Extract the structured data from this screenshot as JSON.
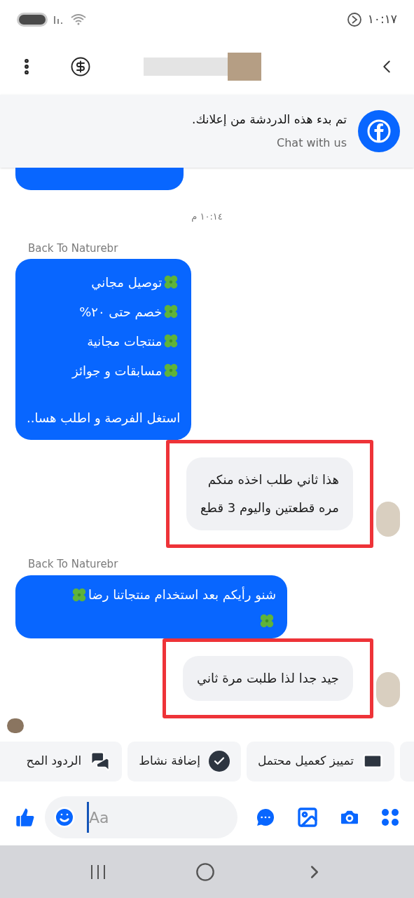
{
  "status_bar": {
    "time": "١٠:١٧"
  },
  "banner": {
    "title": "تم بدء هذه الدردشة من إعلانك.",
    "subtitle": "Chat with us"
  },
  "messages": [
    {
      "kind": "cut_incoming"
    },
    {
      "kind": "time",
      "text": "١٠:١٤ م"
    },
    {
      "kind": "sender",
      "text": "Back To Naturebr"
    },
    {
      "kind": "incoming_list",
      "lines": [
        "توصيل مجاني",
        "خصم حتى ٢٠%",
        "منتجات مجانية",
        "مسابقات و جوائز"
      ],
      "footer": "استغل الفرصة و اطلب هسا.."
    },
    {
      "kind": "outgoing",
      "lines": [
        "هذا ثاني طلب اخذه منكم",
        "مره قطعتين واليوم 3 قطع"
      ],
      "highlighted": true
    },
    {
      "kind": "sender",
      "text": "Back To Naturebr"
    },
    {
      "kind": "incoming_clover",
      "text": "شنو رأيكم بعد استخدام منتجاتنا رضا"
    },
    {
      "kind": "outgoing",
      "lines": [
        "جيد جدا لذا طلبت مرة ثاني"
      ],
      "highlighted": true
    },
    {
      "kind": "seen"
    }
  ],
  "quick_actions": [
    {
      "label": "تمييز كعميل محتمل",
      "kind": "contact"
    },
    {
      "label": "إضافة نشاط",
      "kind": "check"
    },
    {
      "label": "الردود المح",
      "kind": "replies"
    }
  ],
  "composer": {
    "placeholder": "Aa"
  }
}
